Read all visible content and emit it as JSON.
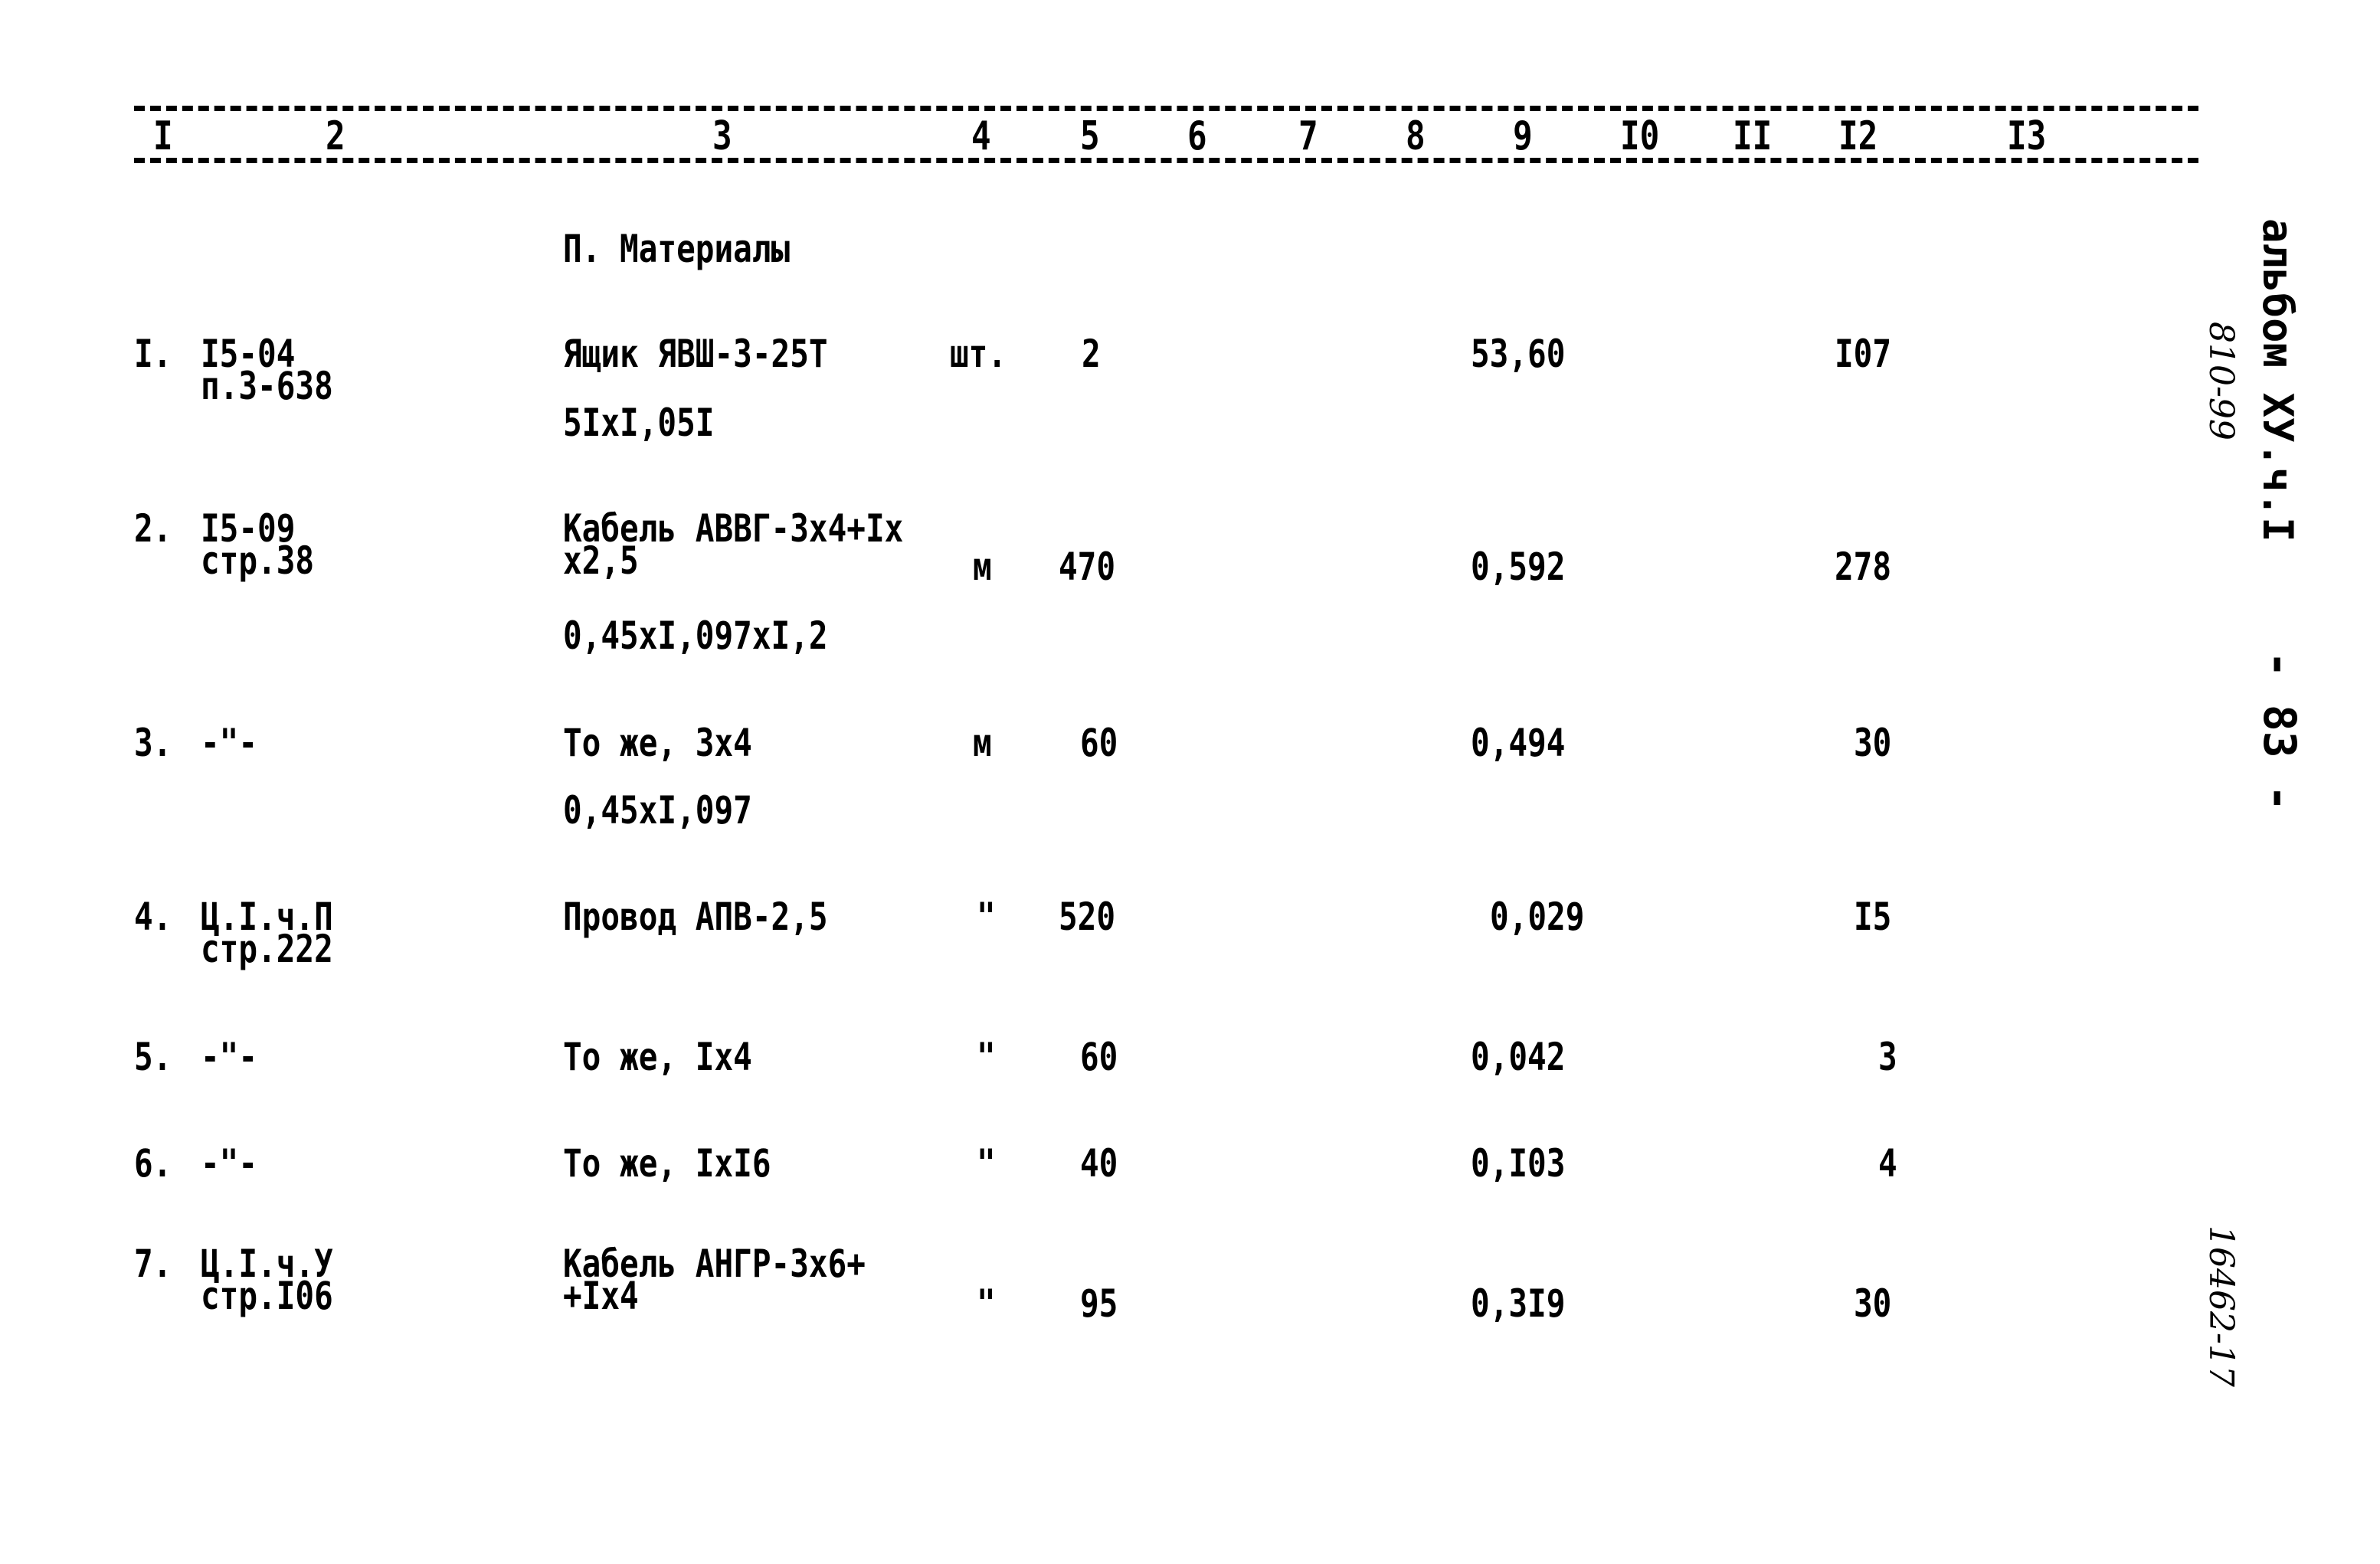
{
  "header": {
    "columns": [
      "I",
      "2",
      "3",
      "4",
      "5",
      "6",
      "7",
      "8",
      "9",
      "I0",
      "II",
      "I2",
      "I3"
    ]
  },
  "section_title": "П. Материалы",
  "rows": [
    {
      "num": "I.",
      "ref_line1": "I5-04",
      "ref_line2": "п.3-638",
      "name_line1": "Ящик ЯВШ-3-25Т",
      "name_line2": "",
      "formula": "5IxI,05I",
      "unit": "шт.",
      "qty": "2",
      "price": "53,60",
      "total": "I07"
    },
    {
      "num": "2.",
      "ref_line1": "I5-09",
      "ref_line2": "стр.38",
      "name_line1": "Кабель АВВГ-3х4+Iх",
      "name_line2": "х2,5",
      "formula": "0,45xI,097xI,2",
      "unit": "м",
      "qty": "470",
      "price": "0,592",
      "total": "278"
    },
    {
      "num": "3.",
      "ref_line1": "-\"-",
      "ref_line2": "",
      "name_line1": "То же, 3х4",
      "name_line2": "",
      "formula": "0,45xI,097",
      "unit": "м",
      "qty": "60",
      "price": "0,494",
      "total": "30"
    },
    {
      "num": "4.",
      "ref_line1": "Ц.I.ч.П",
      "ref_line2": "стр.222",
      "name_line1": "Провод АПВ-2,5",
      "name_line2": "",
      "formula": "",
      "unit": "\"",
      "qty": "520",
      "price": "0,029",
      "total": "I5"
    },
    {
      "num": "5.",
      "ref_line1": "-\"-",
      "ref_line2": "",
      "name_line1": "То же, Iх4",
      "name_line2": "",
      "formula": "",
      "unit": "\"",
      "qty": "60",
      "price": "0,042",
      "total": "3"
    },
    {
      "num": "6.",
      "ref_line1": "-\"-",
      "ref_line2": "",
      "name_line1": "То же, IхI6",
      "name_line2": "",
      "formula": "",
      "unit": "\"",
      "qty": "40",
      "price": "0,I03",
      "total": "4"
    },
    {
      "num": "7.",
      "ref_line1": "Ц.I.ч.У",
      "ref_line2": "стр.I06",
      "name_line1": "Кабель АНГР-3х6+",
      "name_line2": "+Iх4",
      "formula": "",
      "unit": "\"",
      "qty": "95",
      "price": "0,3I9",
      "total": "30"
    }
  ],
  "margin": {
    "album": "альбом ХУ.ч.I",
    "page_number": "- 83 -",
    "handwritten_top": "810-99",
    "handwritten_bottom": "16462-17"
  }
}
